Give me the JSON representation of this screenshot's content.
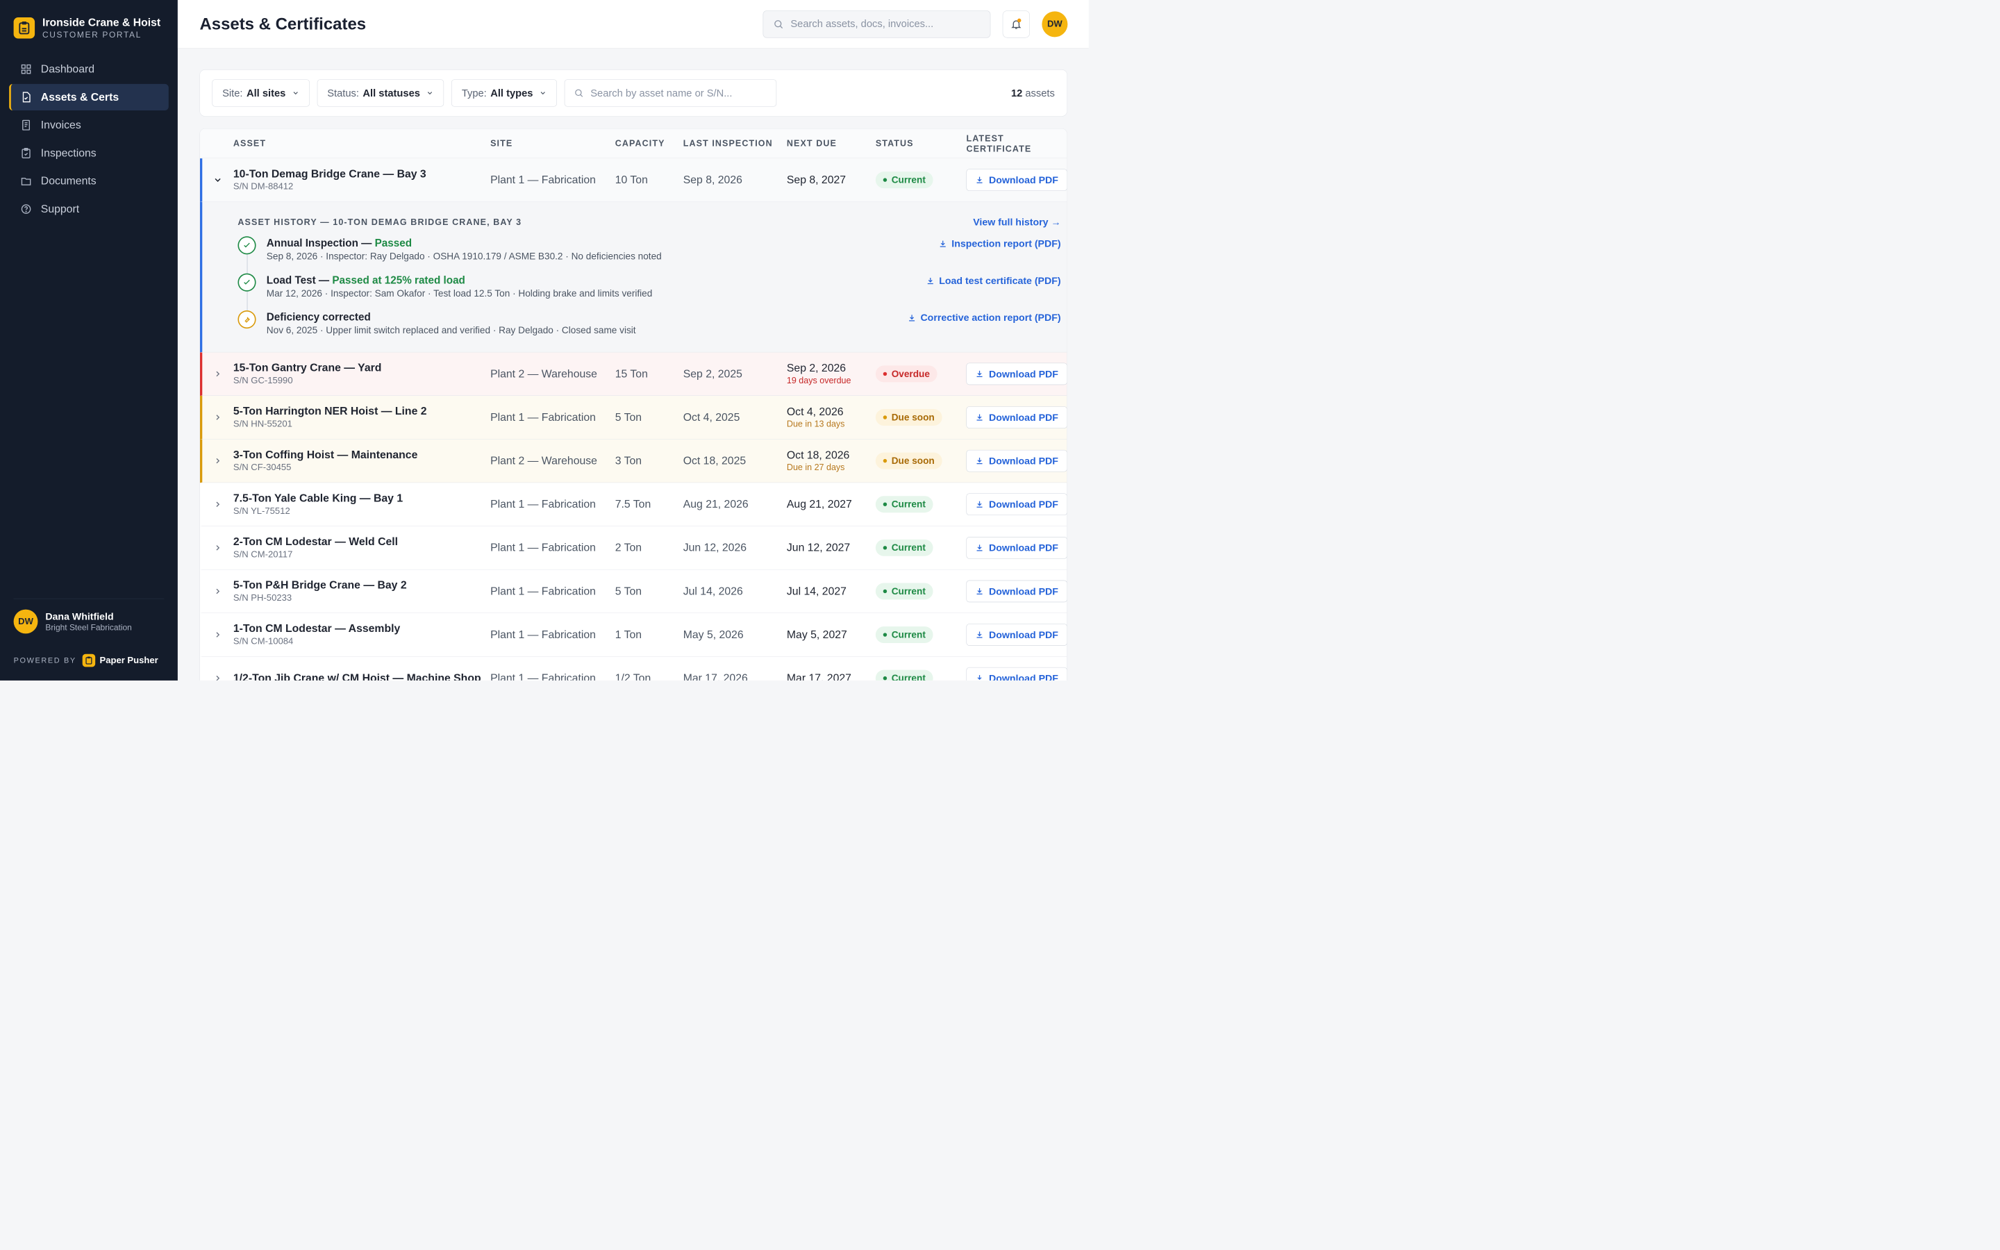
{
  "brand": {
    "name": "Ironside Crane & Hoist",
    "subtitle": "CUSTOMER PORTAL"
  },
  "nav": [
    {
      "label": "Dashboard",
      "icon": "grid-icon"
    },
    {
      "label": "Assets & Certs",
      "icon": "document-check-icon",
      "active": true
    },
    {
      "label": "Invoices",
      "icon": "receipt-icon"
    },
    {
      "label": "Inspections",
      "icon": "clipboard-check-icon"
    },
    {
      "label": "Documents",
      "icon": "folder-icon"
    },
    {
      "label": "Support",
      "icon": "help-circle-icon"
    }
  ],
  "user": {
    "initials": "DW",
    "name": "Dana Whitfield",
    "org": "Bright Steel Fabrication"
  },
  "powered": {
    "label": "POWERED BY",
    "name": "Paper Pusher"
  },
  "header": {
    "title": "Assets & Certificates",
    "search_placeholder": "Search assets, docs, invoices...",
    "avatar": "DW"
  },
  "filters": {
    "site": {
      "label": "Site:",
      "value": "All sites"
    },
    "status": {
      "label": "Status:",
      "value": "All statuses"
    },
    "type": {
      "label": "Type:",
      "value": "All types"
    },
    "search_placeholder": "Search by asset name or S/N...",
    "count": "12",
    "count_label": "assets"
  },
  "columns": [
    "ASSET",
    "SITE",
    "CAPACITY",
    "LAST INSPECTION",
    "NEXT DUE",
    "STATUS",
    "LATEST CERTIFICATE"
  ],
  "download_label": "Download PDF",
  "history": {
    "title": "ASSET HISTORY — 10-TON DEMAG BRIDGE CRANE, BAY 3",
    "view_link": "View full history →",
    "events": [
      {
        "title": "Annual Inspection — ",
        "result": "Passed",
        "meta": "Sep 8, 2026 · Inspector: Ray Delgado · OSHA 1910.179 / ASME B30.2 · No deficiencies noted",
        "link": "Inspection report (PDF)"
      },
      {
        "title": "Load Test — ",
        "result": "Passed at 125% rated load",
        "meta": "Mar 12, 2026 · Inspector: Sam Okafor · Test load 12.5 Ton · Holding brake and limits verified",
        "link": "Load test certificate (PDF)"
      },
      {
        "title": "Deficiency corrected",
        "result": "",
        "meta": "Nov 6, 2025 · Upper limit switch replaced and verified · Ray Delgado · Closed same visit",
        "link": "Corrective action report (PDF)"
      }
    ]
  },
  "assets": [
    {
      "name": "10-Ton Demag Bridge Crane — Bay 3",
      "sn": "S/N DM-88412",
      "site": "Plant 1 — Fabrication",
      "capacity": "10 Ton",
      "last": "Sep 8, 2026",
      "next": "Sep 8, 2027",
      "next_sub": "",
      "status": "Current"
    },
    {
      "name": "15-Ton Gantry Crane — Yard",
      "sn": "S/N GC-15990",
      "site": "Plant 2 — Warehouse",
      "capacity": "15 Ton",
      "last": "Sep 2, 2025",
      "next": "Sep 2, 2026",
      "next_sub": "19 days overdue",
      "status": "Overdue"
    },
    {
      "name": "5-Ton Harrington NER Hoist — Line 2",
      "sn": "S/N HN-55201",
      "site": "Plant 1 — Fabrication",
      "capacity": "5 Ton",
      "last": "Oct 4, 2025",
      "next": "Oct 4, 2026",
      "next_sub": "Due in 13 days",
      "status": "Due soon"
    },
    {
      "name": "3-Ton Coffing Hoist — Maintenance",
      "sn": "S/N CF-30455",
      "site": "Plant 2 — Warehouse",
      "capacity": "3 Ton",
      "last": "Oct 18, 2025",
      "next": "Oct 18, 2026",
      "next_sub": "Due in 27 days",
      "status": "Due soon"
    },
    {
      "name": "7.5-Ton Yale Cable King — Bay 1",
      "sn": "S/N YL-75512",
      "site": "Plant 1 — Fabrication",
      "capacity": "7.5 Ton",
      "last": "Aug 21, 2026",
      "next": "Aug 21, 2027",
      "next_sub": "",
      "status": "Current"
    },
    {
      "name": "2-Ton CM Lodestar — Weld Cell",
      "sn": "S/N CM-20117",
      "site": "Plant 1 — Fabrication",
      "capacity": "2 Ton",
      "last": "Jun 12, 2026",
      "next": "Jun 12, 2027",
      "next_sub": "",
      "status": "Current"
    },
    {
      "name": "5-Ton P&H Bridge Crane — Bay 2",
      "sn": "S/N PH-50233",
      "site": "Plant 1 — Fabrication",
      "capacity": "5 Ton",
      "last": "Jul 14, 2026",
      "next": "Jul 14, 2027",
      "next_sub": "",
      "status": "Current"
    },
    {
      "name": "1-Ton CM Lodestar — Assembly",
      "sn": "S/N CM-10084",
      "site": "Plant 1 — Fabrication",
      "capacity": "1 Ton",
      "last": "May 5, 2026",
      "next": "May 5, 2027",
      "next_sub": "",
      "status": "Current"
    },
    {
      "name": "1/2-Ton Jib Crane w/ CM Hoist — Machine Shop",
      "sn": "",
      "site": "Plant 1 — Fabrication",
      "capacity": "1/2 Ton",
      "last": "Mar 17, 2026",
      "next": "Mar 17, 2027",
      "next_sub": "",
      "status": "Current"
    }
  ],
  "colors": {
    "sidebar": "#141c2b",
    "accent": "#f5b50f",
    "link": "#2563d9",
    "current": "#1e8a45",
    "overdue": "#dc2f2f",
    "due_soon": "#d99a0b"
  }
}
